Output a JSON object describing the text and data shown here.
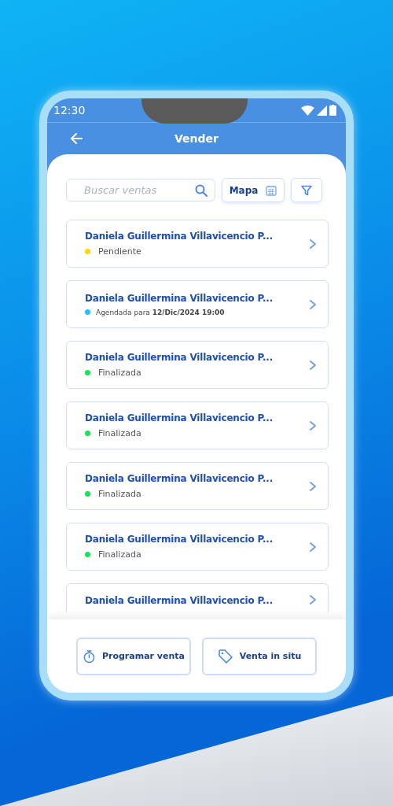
{
  "status_bar": {
    "time": "12:30"
  },
  "header": {
    "title": "Vender"
  },
  "search": {
    "placeholder": "Buscar ventas"
  },
  "map_button": {
    "label": "Mapa"
  },
  "sales": [
    {
      "name": "Daniela Guillermina Villavicencio P...",
      "status": {
        "kind": "plain",
        "text": "Pendiente",
        "color": "#ffd600"
      }
    },
    {
      "name": "Daniela Guillermina Villavicencio P...",
      "status": {
        "kind": "scheduled",
        "text": "Agendada para **12/Dic/2024  19:00**",
        "color": "#1ec3ff"
      }
    },
    {
      "name": "Daniela Guillermina Villavicencio P...",
      "status": {
        "kind": "plain",
        "text": "Finalizada",
        "color": "#19e35a"
      }
    },
    {
      "name": "Daniela Guillermina Villavicencio P...",
      "status": {
        "kind": "plain",
        "text": "Finalizada",
        "color": "#19e35a"
      }
    },
    {
      "name": "Daniela Guillermina Villavicencio P...",
      "status": {
        "kind": "plain",
        "text": "Finalizada",
        "color": "#19e35a"
      }
    },
    {
      "name": "Daniela Guillermina Villavicencio P...",
      "status": {
        "kind": "plain",
        "text": "Finalizada",
        "color": "#19e35a"
      }
    },
    {
      "name": "Daniela Guillermina Villavicencio P..."
    }
  ],
  "actions": [
    {
      "kind": "schedule",
      "label": "Programar venta"
    },
    {
      "kind": "tag",
      "label": "Venta in situ"
    }
  ]
}
